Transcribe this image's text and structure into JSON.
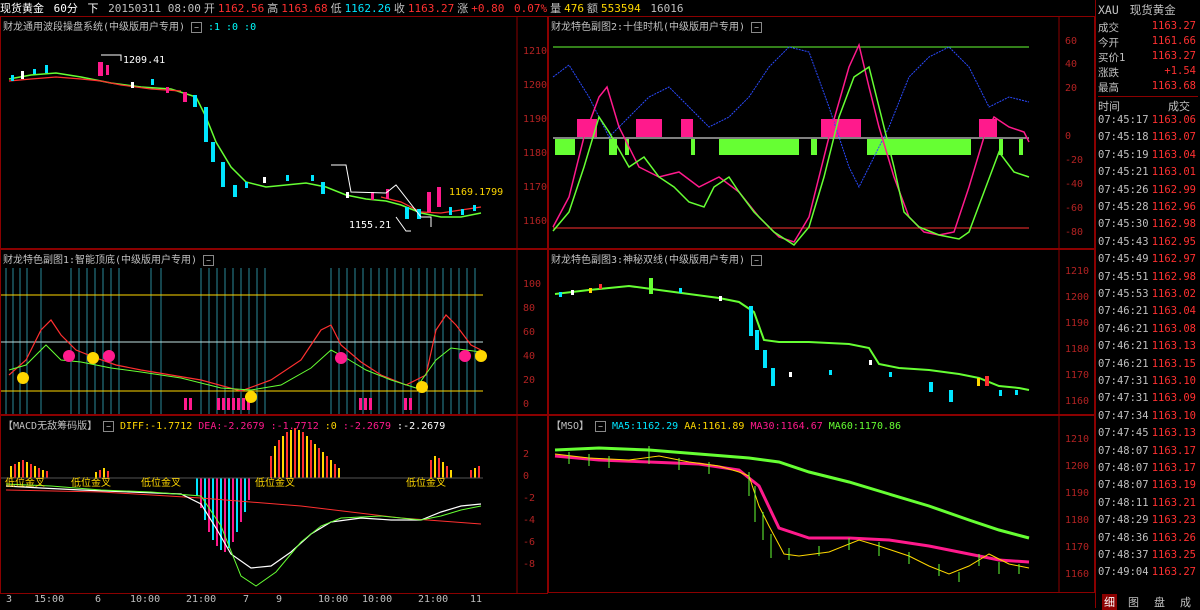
{
  "topbar": {
    "symbol": "现货黄金",
    "period": "60分",
    "mode": "下",
    "datetime": "20150311 08:00",
    "open_label": "开",
    "open": "1162.56",
    "high_label": "高",
    "high": "1163.68",
    "low_label": "低",
    "low": "1162.26",
    "close_label": "收",
    "close": "1163.27",
    "change_label": "涨",
    "change": "+0.80",
    "change_pct": "0.07%",
    "volume_label": "量",
    "volume": "476",
    "amount_label": "额",
    "amount": "553594",
    "extra": "16016"
  },
  "panels": {
    "main": {
      "title": "财龙通用波段操盘系统(中级版用户专用)",
      "indicators": ":1 :0 :0",
      "yticks": [
        "1210.0",
        "1200.0",
        "1190.0",
        "1180.0",
        "1170.0",
        "1160.0"
      ],
      "labels": {
        "high": "1209.41",
        "low": "1155.21",
        "last": "1169.1799"
      }
    },
    "sub1": {
      "title": "财龙特色副图1:智能顶底(中级版用户专用)",
      "yticks": [
        "100",
        "80",
        "60",
        "40",
        "20",
        "0"
      ]
    },
    "macd": {
      "title": "【MACD无敌筹码版】",
      "diff_label": "DIFF:",
      "diff": "-1.7712",
      "dea_label": "DEA:",
      "dea": "-2.2679",
      "v1": ":-1.7712",
      "v2": ":0",
      "v3": ":-2.2679",
      "v4": ":-2.2679",
      "yticks": [
        "2",
        "0",
        "-2",
        "-4",
        "-6",
        "-8"
      ],
      "annotations": [
        "低位金叉",
        "低位金叉",
        "低位金叉",
        "低位金叉",
        "低位金叉"
      ]
    },
    "right1": {
      "title": "财龙特色副图2:十佳时机(中级版用户专用)",
      "yticks": [
        "60",
        "40",
        "20",
        "0",
        "-20",
        "-40",
        "-60",
        "-80"
      ]
    },
    "right2": {
      "title": "财龙特色副图3:神秘双线(中级版用户专用)",
      "yticks": [
        "1210",
        "1200",
        "1190",
        "1180",
        "1170",
        "1160"
      ]
    },
    "right3": {
      "title": "【MSO】",
      "ma5_label": "MA5:",
      "ma5": "1162.29",
      "aa_label": "AA:",
      "aa": "1161.89",
      "ma30_label": "MA30:",
      "ma30": "1164.67",
      "ma60_label": "MA60:",
      "ma60": "1170.86",
      "yticks": [
        "1210",
        "1200",
        "1190",
        "1180",
        "1170",
        "1160"
      ]
    }
  },
  "xaxis": {
    "ticks": [
      "3",
      "15:00",
      "6",
      "10:00",
      "21:00",
      "7",
      "9",
      "10:00",
      "10:00",
      "21:00",
      "11"
    ]
  },
  "quote": {
    "code": "XAU",
    "name": "现货黄金",
    "rows": [
      {
        "label": "成交",
        "value": "1163.27",
        "color": "#ff3030"
      },
      {
        "label": "今开",
        "value": "1161.66",
        "color": "#ff3030"
      },
      {
        "label": "买价1",
        "value": "1163.27",
        "color": "#ff3030"
      },
      {
        "label": "涨跌",
        "value": "+1.54",
        "color": "#ff3030"
      },
      {
        "label": "最高",
        "value": "1163.68",
        "color": "#ff3030"
      }
    ],
    "tick_header_time": "时间",
    "tick_header_price": "成交",
    "ticks": [
      {
        "t": "07:45:17",
        "p": "1163.06"
      },
      {
        "t": "07:45:18",
        "p": "1163.07"
      },
      {
        "t": "07:45:19",
        "p": "1163.04"
      },
      {
        "t": "07:45:21",
        "p": "1163.01"
      },
      {
        "t": "07:45:26",
        "p": "1162.99"
      },
      {
        "t": "07:45:28",
        "p": "1162.96"
      },
      {
        "t": "07:45:30",
        "p": "1162.98"
      },
      {
        "t": "07:45:43",
        "p": "1162.95"
      },
      {
        "t": "07:45:49",
        "p": "1162.97"
      },
      {
        "t": "07:45:51",
        "p": "1162.98"
      },
      {
        "t": "07:45:53",
        "p": "1163.02"
      },
      {
        "t": "07:46:21",
        "p": "1163.04"
      },
      {
        "t": "07:46:21",
        "p": "1163.08"
      },
      {
        "t": "07:46:21",
        "p": "1163.13"
      },
      {
        "t": "07:46:21",
        "p": "1163.15"
      },
      {
        "t": "07:47:31",
        "p": "1163.10"
      },
      {
        "t": "07:47:31",
        "p": "1163.09"
      },
      {
        "t": "07:47:34",
        "p": "1163.10"
      },
      {
        "t": "07:47:45",
        "p": "1163.13"
      },
      {
        "t": "07:48:07",
        "p": "1163.17"
      },
      {
        "t": "07:48:07",
        "p": "1163.17"
      },
      {
        "t": "07:48:07",
        "p": "1163.19"
      },
      {
        "t": "07:48:11",
        "p": "1163.21"
      },
      {
        "t": "07:48:29",
        "p": "1163.23"
      },
      {
        "t": "07:48:36",
        "p": "1163.26"
      },
      {
        "t": "07:48:37",
        "p": "1163.25"
      },
      {
        "t": "07:49:04",
        "p": "1163.27"
      }
    ],
    "bottom_tabs": [
      "细",
      "图",
      "盘",
      "成"
    ]
  },
  "colors": {
    "up": "#ff3030",
    "down": "#00e5ff",
    "ma": "#66ff33",
    "magenta": "#ff1a8c",
    "yellow": "#ffd700",
    "border": "#8b0000"
  }
}
